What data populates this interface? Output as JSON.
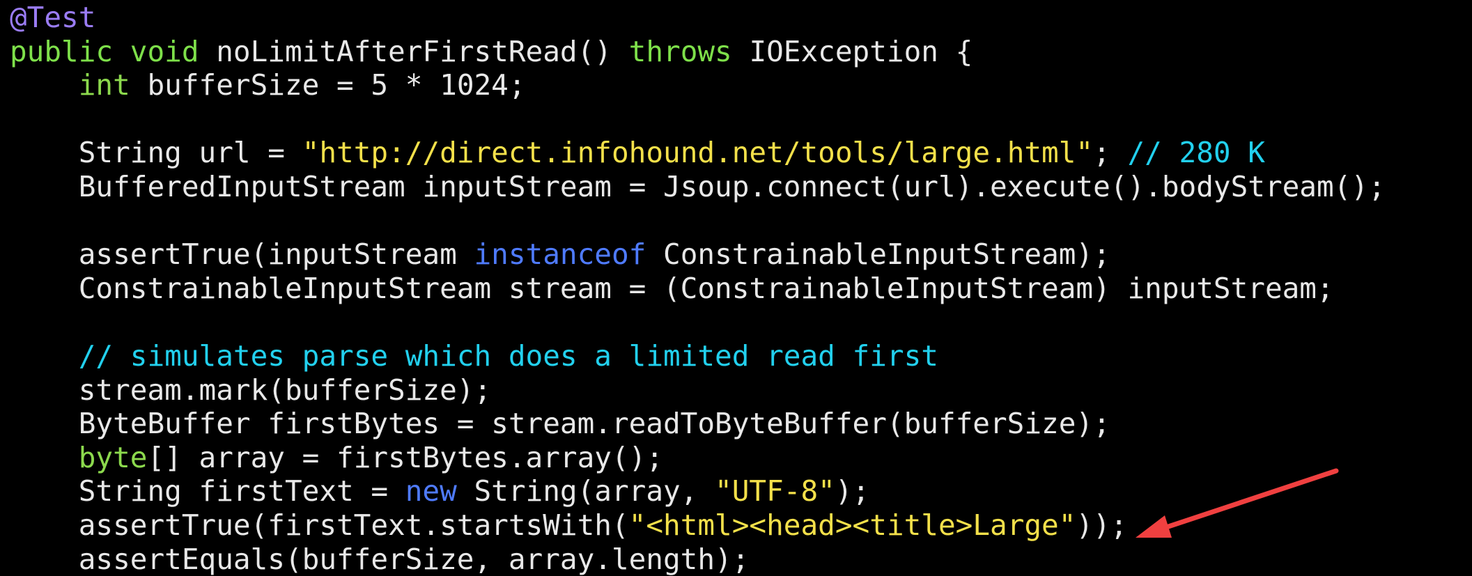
{
  "colors": {
    "background": "#000000",
    "plain": "#e8e8e8",
    "annotation": "#9a7cf4",
    "keyword": "#7ee04a",
    "type": "#8cd94d",
    "keyword_blue": "#4f7bff",
    "string": "#f3e04a",
    "comment": "#22d0ee",
    "arrow": "#f04040"
  },
  "code": {
    "lines": [
      [
        {
          "t": "@Test",
          "k": "annotation"
        }
      ],
      [
        {
          "t": "public void ",
          "k": "keyword"
        },
        {
          "t": "noLimitAfterFirstRead() ",
          "k": "plain"
        },
        {
          "t": "throws ",
          "k": "keyword"
        },
        {
          "t": "IOException {",
          "k": "plain"
        }
      ],
      [
        {
          "t": "    ",
          "k": "plain"
        },
        {
          "t": "int ",
          "k": "type"
        },
        {
          "t": "bufferSize = 5 * 1024;",
          "k": "plain"
        }
      ],
      [],
      [
        {
          "t": "    String url = ",
          "k": "plain"
        },
        {
          "t": "\"http://direct.infohound.net/tools/large.html\"",
          "k": "string"
        },
        {
          "t": "; ",
          "k": "plain"
        },
        {
          "t": "// 280 K",
          "k": "comment"
        }
      ],
      [
        {
          "t": "    BufferedInputStream inputStream = Jsoup.connect(url).execute().bodyStream();",
          "k": "plain"
        }
      ],
      [],
      [
        {
          "t": "    assertTrue(inputStream ",
          "k": "plain"
        },
        {
          "t": "instanceof ",
          "k": "keyword_blue"
        },
        {
          "t": "ConstrainableInputStream);",
          "k": "plain"
        }
      ],
      [
        {
          "t": "    ConstrainableInputStream stream = (ConstrainableInputStream) inputStream;",
          "k": "plain"
        }
      ],
      [],
      [
        {
          "t": "    ",
          "k": "plain"
        },
        {
          "t": "// simulates parse which does a limited read first",
          "k": "comment"
        }
      ],
      [
        {
          "t": "    stream.mark(bufferSize);",
          "k": "plain"
        }
      ],
      [
        {
          "t": "    ByteBuffer firstBytes = stream.readToByteBuffer(bufferSize);",
          "k": "plain"
        }
      ],
      [
        {
          "t": "    ",
          "k": "plain"
        },
        {
          "t": "byte",
          "k": "type"
        },
        {
          "t": "[] array = firstBytes.array();",
          "k": "plain"
        }
      ],
      [
        {
          "t": "    String firstText = ",
          "k": "plain"
        },
        {
          "t": "new ",
          "k": "keyword_blue"
        },
        {
          "t": "String(array, ",
          "k": "plain"
        },
        {
          "t": "\"UTF-8\"",
          "k": "string"
        },
        {
          "t": ");",
          "k": "plain"
        }
      ],
      [
        {
          "t": "    assertTrue(firstText.startsWith(",
          "k": "plain"
        },
        {
          "t": "\"<html><head><title>Large\"",
          "k": "string"
        },
        {
          "t": "));",
          "k": "plain"
        }
      ],
      [
        {
          "t": "    assertEquals(bufferSize, array.length);",
          "k": "plain"
        }
      ]
    ]
  },
  "annotation_arrow": {
    "icon": "red-arrow-icon",
    "points_to": "\"<html><head><title>Large\""
  }
}
